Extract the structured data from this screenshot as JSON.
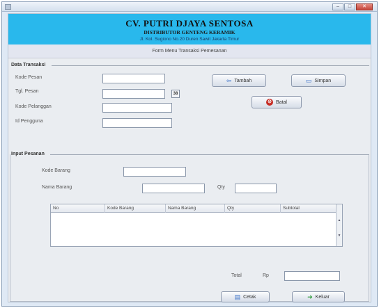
{
  "header": {
    "company": "CV. PUTRI DJAYA SENTOSA",
    "subtitle": "DISTRIBUTOR GENTENG KERAMIK",
    "address": "Jl. Kol. Sugiono No.20 Duren Sawit Jakarta Timur"
  },
  "form_title": "Form Menu Transaksi Pemesanan",
  "data_transaksi": {
    "section_label": "Data Transaksi",
    "labels": {
      "kode_pesan": "Kode Pesan",
      "tgl_pesan": "Tgl. Pesan",
      "kode_pelanggan": "Kode Pelanggan",
      "id_pengguna": "Id Pengguna"
    },
    "calendar_icon_text": "38",
    "buttons": {
      "tambah": "Tambah",
      "simpan": "Simpan",
      "batal": "Batal"
    }
  },
  "input_pesanan": {
    "section_label": "Input Pesanan",
    "labels": {
      "kode_barang": "Kode Barang",
      "nama_barang": "Nama Barang",
      "qty": "Qty"
    },
    "table_headers": [
      "No",
      "Kode Barang",
      "Nama Barang",
      "Qty",
      "Subtotal"
    ],
    "total_label": "Total",
    "currency": "Rp",
    "buttons": {
      "cetak": "Cetak",
      "keluar": "Keluar"
    }
  },
  "icons": {
    "tambah": "add-arrow-icon",
    "simpan": "save-icon",
    "batal": "cancel-icon",
    "cetak": "print-icon",
    "keluar": "exit-arrow-icon"
  },
  "colors": {
    "header_bg": "#29b8ec",
    "form_bg": "#eaedf1"
  }
}
